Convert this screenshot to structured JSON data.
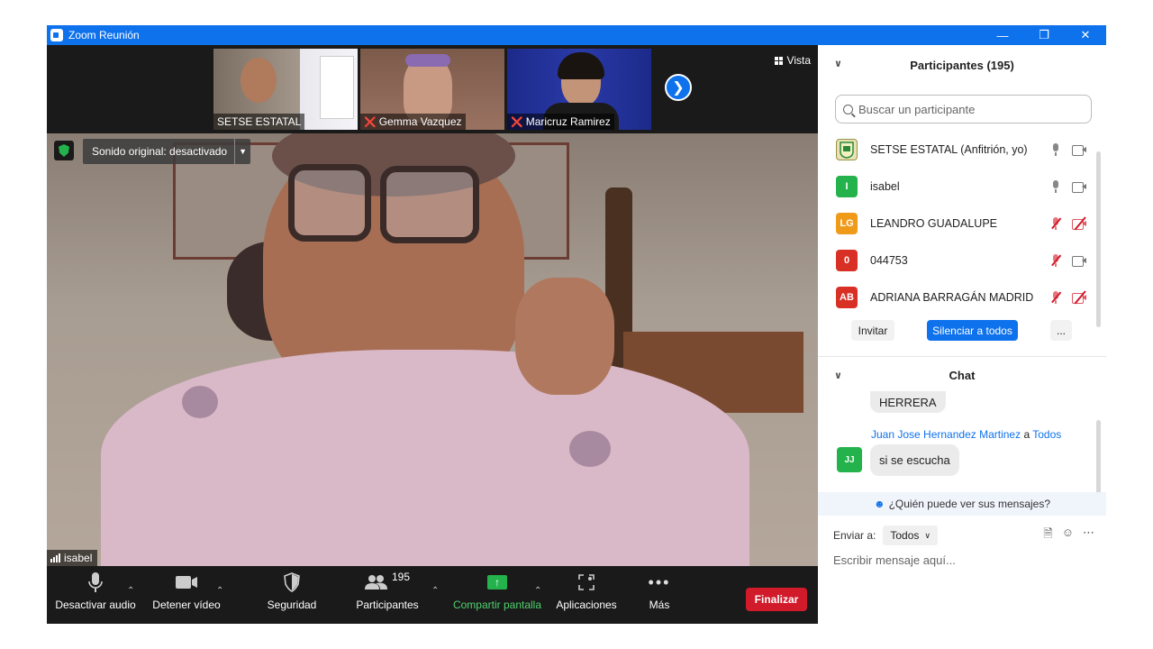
{
  "window": {
    "title": "Zoom Reunión",
    "accent": "#0e72ed"
  },
  "thumbnails": [
    {
      "name": "SETSE ESTATAL",
      "muted": false
    },
    {
      "name": "Gemma Vazquez",
      "muted": true
    },
    {
      "name": "Maricruz Ramirez",
      "muted": true
    }
  ],
  "view_label": "Vista",
  "original_sound": "Sonido original: desactivado",
  "active_speaker": "isabel",
  "toolbar": {
    "audio": "Desactivar audio",
    "video": "Detener vídeo",
    "security": "Seguridad",
    "participants": "Participantes",
    "participants_count": "195",
    "share": "Compartir pantalla",
    "apps": "Aplicaciones",
    "more": "Más",
    "end": "Finalizar",
    "end_color": "#d11a2a",
    "share_color": "#23b24b"
  },
  "participants_panel": {
    "title": "Participantes (195)",
    "search_placeholder": "Buscar un participante",
    "people": [
      {
        "initials": "",
        "name": "SETSE ESTATAL (Anfitrión, yo)",
        "color": "#e8e2b8",
        "mic": "on",
        "cam": "on"
      },
      {
        "initials": "I",
        "name": "isabel",
        "color": "#23b24b",
        "mic": "on",
        "cam": "on"
      },
      {
        "initials": "LG",
        "name": "LEANDRO GUADALUPE",
        "color": "#f09a1a",
        "mic": "off",
        "cam": "off"
      },
      {
        "initials": "0",
        "name": "044753",
        "color": "#d93025",
        "mic": "off",
        "cam": "on"
      },
      {
        "initials": "AB",
        "name": "ADRIANA BARRAGÁN MADRID",
        "color": "#d93025",
        "mic": "off",
        "cam": "off"
      }
    ],
    "invite": "Invitar",
    "mute_all": "Silenciar a todos",
    "more": "..."
  },
  "chat": {
    "title": "Chat",
    "prev_message": "HERRERA",
    "sender": "Juan Jose Hernandez Martinez",
    "to_word": "a",
    "recipient": "Todos",
    "sender_initials": "JJ",
    "message": "si se escucha",
    "who_can_see": "¿Quién puede ver sus mensajes?",
    "send_to_label": "Enviar a:",
    "send_to_value": "Todos",
    "input_placeholder": "Escribir mensaje aquí..."
  }
}
